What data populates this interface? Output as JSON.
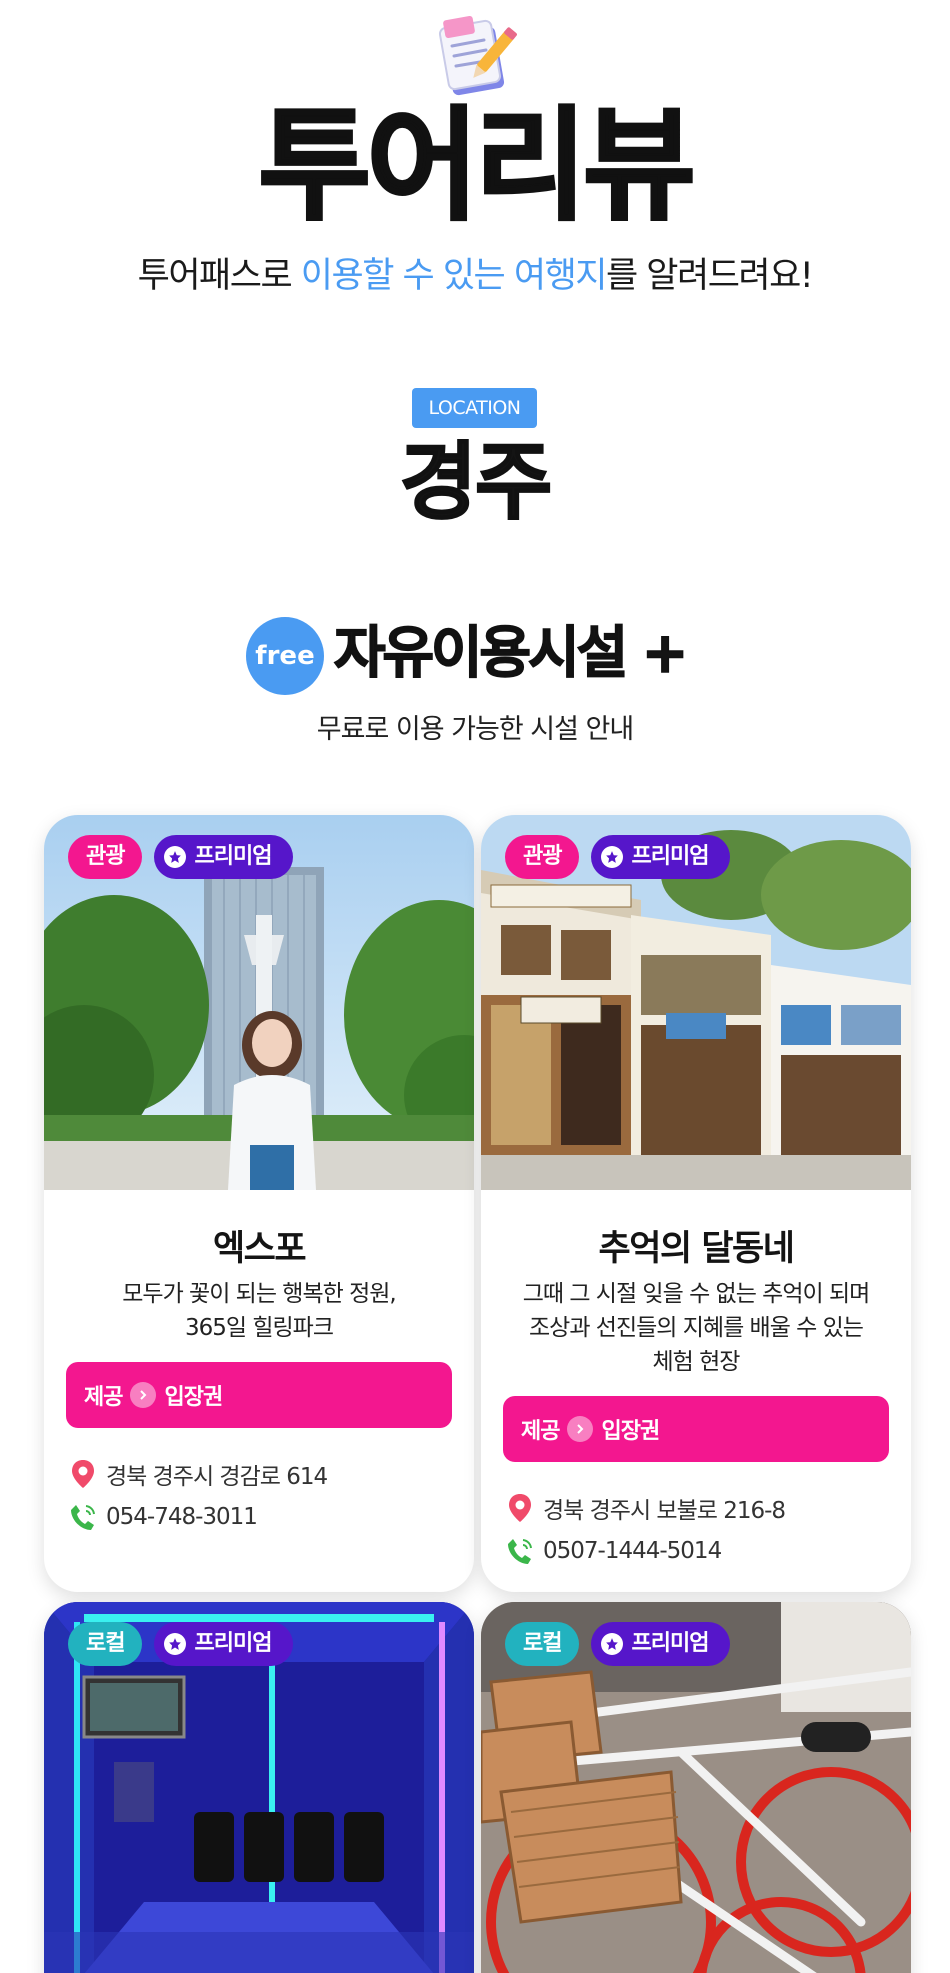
{
  "hero": {
    "title": "투어리뷰",
    "subtitle_pre": "투어패스로 ",
    "subtitle_highlight": "이용할 수 있는 여행지",
    "subtitle_post": "를 알려드려요!"
  },
  "location": {
    "badge": "LOCATION",
    "name": "경주"
  },
  "free_section": {
    "circle_label": "free",
    "title": "자유이용시설 +",
    "subtitle": "무료로 이용 가능한 시설 안내"
  },
  "colors": {
    "accent_blue": "#4a9bf2",
    "pink": "#f3178f",
    "purple": "#5616ca",
    "teal": "#22b2bf"
  },
  "cards": [
    {
      "category": "관광",
      "premium": "프리미엄",
      "name": "엑스포",
      "desc": [
        "모두가 꽃이 되는 행복한 정원,",
        "365일 힐링파크"
      ],
      "provide_label": "제공",
      "provide_item": "입장권",
      "address": "경북 경주시 경감로 614",
      "phone": "054-748-3011"
    },
    {
      "category": "관광",
      "premium": "프리미엄",
      "name": "추억의 달동네",
      "desc": [
        "그때 그 시절 잊을 수 없는 추억이 되며",
        "조상과 선진들의 지혜를 배울 수 있는",
        "체험 현장"
      ],
      "provide_label": "제공",
      "provide_item": "입장권",
      "address": "경북 경주시 보불로 216-8",
      "phone": "0507-1444-5014"
    },
    {
      "category": "로컬",
      "premium": "프리미엄"
    },
    {
      "category": "로컬",
      "premium": "프리미엄"
    }
  ],
  "icons": {
    "hero": "memo-pencil-icon",
    "premium": "star-icon",
    "provide": "chevron-right-icon",
    "address": "location-pin-icon",
    "phone": "phone-icon"
  }
}
